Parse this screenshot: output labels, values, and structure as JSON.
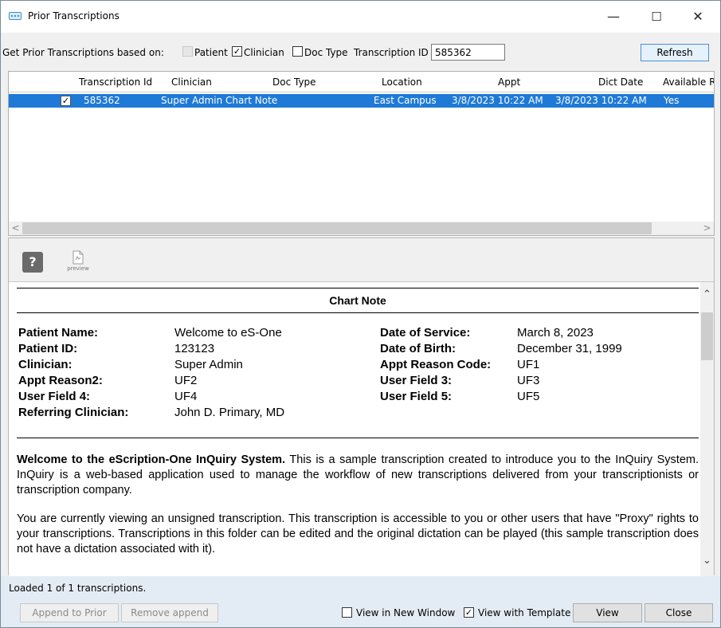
{
  "window": {
    "title": "Prior Transcriptions",
    "minimize": "—",
    "maximize": "☐",
    "close": "✕"
  },
  "search": {
    "based_on_label": "Get Prior Transcriptions based on:",
    "patient_label": "Patient",
    "patient_checked": false,
    "clinician_label": "Clinician",
    "clinician_checked": true,
    "doctype_label": "Doc Type",
    "doctype_checked": false,
    "transcription_id_label": "Transcription ID",
    "transcription_id_value": "585362",
    "refresh_label": "Refresh"
  },
  "grid": {
    "columns": [
      "Transcription Id",
      "Clinician",
      "Doc Type",
      "Location",
      "Appt",
      "Dict Date",
      "Available R"
    ],
    "rows": [
      {
        "checked": true,
        "transcription_id": "585362",
        "clinician": "Super Admin",
        "doc_type": "Chart Note",
        "location": "East Campus",
        "appt": "3/8/2023 10:22 AM",
        "dict_date": "3/8/2023 10:22 AM",
        "available": "Yes"
      }
    ],
    "scroll_left": "<",
    "scroll_right": ">"
  },
  "toolbar": {
    "help_glyph": "?",
    "preview_label": "preview"
  },
  "document": {
    "title": "Chart Note",
    "fields_left": [
      {
        "label": "Patient Name:",
        "value": "Welcome to eS-One"
      },
      {
        "label": "Patient ID:",
        "value": "123123"
      },
      {
        "label": "Clinician:",
        "value": "Super Admin"
      },
      {
        "label": "Appt Reason2:",
        "value": "UF2"
      },
      {
        "label": "User Field 4:",
        "value": "UF4"
      },
      {
        "label": "Referring Clinician:",
        "value": "John D. Primary, MD"
      }
    ],
    "fields_right": [
      {
        "label": "Date of Service:",
        "value": "March 8, 2023"
      },
      {
        "label": "Date of Birth:",
        "value": "December 31, 1999"
      },
      {
        "label": "Appt Reason Code:",
        "value": "UF1"
      },
      {
        "label": "User Field 3:",
        "value": "UF3"
      },
      {
        "label": "User Field 5:",
        "value": "UF5"
      }
    ],
    "para1_bold": "Welcome to the eScription-One InQuiry System.",
    "para1_rest": " This is a sample transcription created to introduce you to the InQuiry System. InQuiry is a web-based application used to manage the workflow of new transcriptions delivered from your transcriptionists or transcription company.",
    "para2": "You are currently viewing an unsigned transcription. This transcription is accessible to you or other users that have \"Proxy\" rights to your transcriptions. Transcriptions in this folder can be edited and the original dictation can be played (this sample transcription does not have a dictation associated with it)."
  },
  "footer": {
    "status": "Loaded 1 of 1 transcriptions.",
    "append_label": "Append to Prior",
    "remove_append_label": "Remove append",
    "view_new_window_label": "View in New Window",
    "view_new_window_checked": false,
    "view_template_label": "View with Template",
    "view_template_checked": true,
    "view_label": "View",
    "close_label": "Close"
  },
  "colors": {
    "selection": "#1e7ad6",
    "footer_bg": "#e3ecf4",
    "refresh_border": "#4b8fd3"
  }
}
